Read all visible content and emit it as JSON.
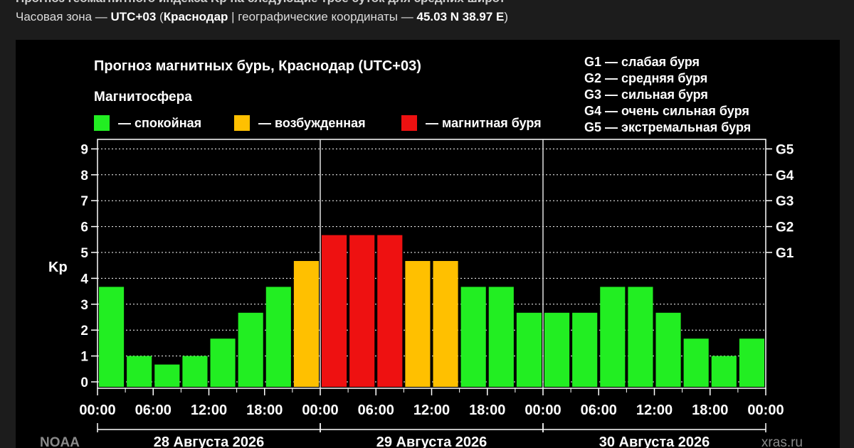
{
  "header": {
    "top_cut_text": "Прогноз геомагнитного индекса Kp на следующие трое суток для средних широт",
    "tz_label": "Часовая зона — ",
    "tz_value": "UTC+03",
    "paren_open": " (",
    "city": "Краснодар",
    "coords_label": " | географические координаты — ",
    "coords_value": "45.03 N 38.97 E",
    "paren_close": ")"
  },
  "chart_data": {
    "type": "bar",
    "title": "Прогноз магнитных бурь, Краснодар (UTC+03)",
    "legend_title": "Магнитосфера",
    "legend": [
      {
        "label": "— спокойная",
        "color": "#22ee22"
      },
      {
        "label": "— возбужденная",
        "color": "#ffc000"
      },
      {
        "label": "— магнитная буря",
        "color": "#ee1111"
      }
    ],
    "storm_scale": [
      "G1 — слабая буря",
      "G2 — средняя буря",
      "G3 — сильная буря",
      "G4 — очень сильная буря",
      "G5 — экстремальная буря"
    ],
    "ylabel": "Kp",
    "ylim": [
      0,
      9
    ],
    "yticks": [
      "0",
      "1",
      "2",
      "3",
      "4",
      "5",
      "6",
      "7",
      "8",
      "9"
    ],
    "right_ticks": [
      {
        "label": "G1",
        "kp": 5
      },
      {
        "label": "G2",
        "kp": 6
      },
      {
        "label": "G3",
        "kp": 7
      },
      {
        "label": "G4",
        "kp": 8
      },
      {
        "label": "G5",
        "kp": 9
      }
    ],
    "x_tick_labels": [
      "00:00",
      "06:00",
      "12:00",
      "18:00",
      "00:00",
      "06:00",
      "12:00",
      "18:00",
      "00:00",
      "06:00",
      "12:00",
      "18:00",
      "00:00"
    ],
    "days": [
      "28 Августа 2026",
      "29 Августа 2026",
      "30 Августа 2026"
    ],
    "values": [
      3.67,
      1.0,
      0.67,
      1.0,
      1.67,
      2.67,
      3.67,
      4.67,
      5.67,
      5.67,
      5.67,
      4.67,
      4.67,
      3.67,
      3.67,
      2.67,
      2.67,
      2.67,
      3.67,
      3.67,
      2.67,
      1.67,
      1.0,
      1.67
    ],
    "grid": true,
    "source_left": "NOAA",
    "source_right": "xras.ru"
  }
}
